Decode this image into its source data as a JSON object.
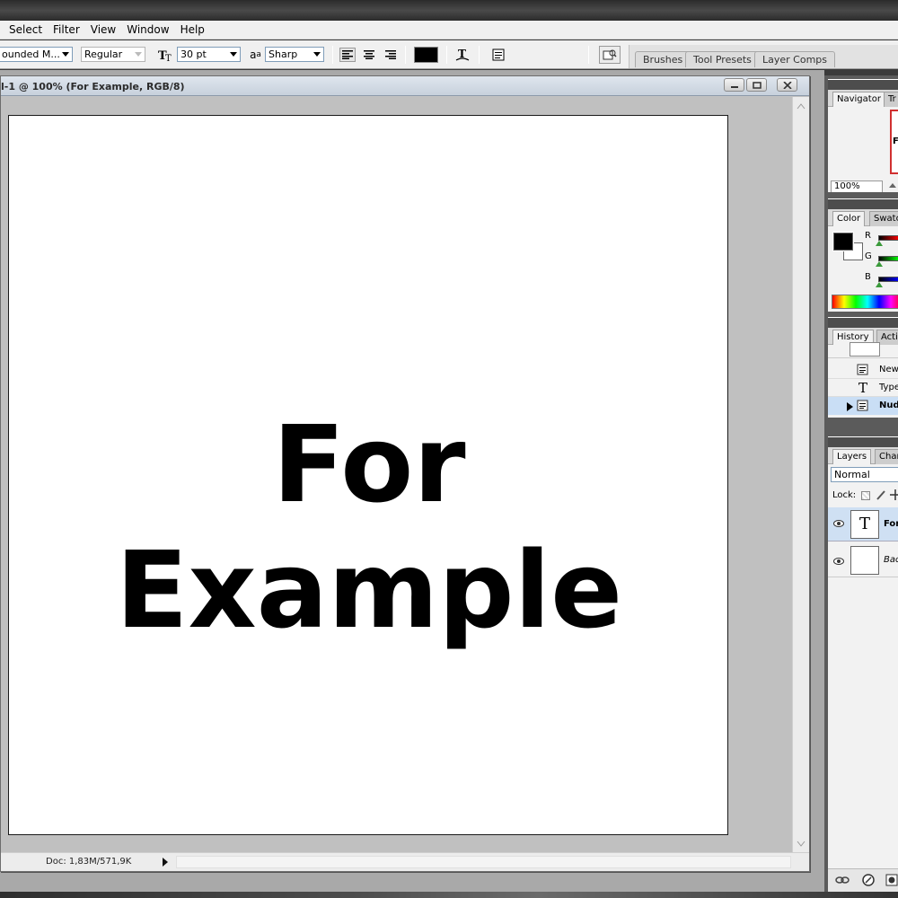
{
  "menubar": {
    "items": [
      "Select",
      "Filter",
      "View",
      "Window",
      "Help"
    ]
  },
  "options": {
    "font_family": "ounded M...",
    "font_style": "Regular",
    "font_size": "30 pt",
    "antialias_icon_label": "a",
    "antialias_icon_label2": "a",
    "antialias": "Sharp",
    "text_color": "#000000"
  },
  "palette_well": {
    "tabs": [
      "Brushes",
      "Tool Presets",
      "Layer Comps"
    ]
  },
  "document": {
    "title": "l-1 @ 100% (For Example, RGB/8)",
    "canvas_text": "For Example",
    "status": "Doc: 1,83M/571,9K"
  },
  "navigator": {
    "tabs": [
      "Navigator",
      "Tr"
    ],
    "zoom": "100%",
    "thumb_text": "Fo"
  },
  "color_panel": {
    "tabs": [
      "Color",
      "Swatc"
    ],
    "channels": [
      "R",
      "G",
      "B"
    ],
    "foreground": "#000000",
    "background": "#ffffff"
  },
  "history": {
    "tabs": [
      "History",
      "Actio"
    ],
    "items": [
      "New",
      "Type",
      "Nudg"
    ]
  },
  "layers": {
    "tabs": [
      "Layers",
      "Chan"
    ],
    "blend_mode": "Normal",
    "lock_label": "Lock:",
    "items": [
      {
        "thumb": "T",
        "name": "For"
      },
      {
        "thumb": "",
        "name": "Bac"
      }
    ]
  },
  "colors": {
    "selection": "#c9def5",
    "layer_selected": "#cfe0f3"
  }
}
